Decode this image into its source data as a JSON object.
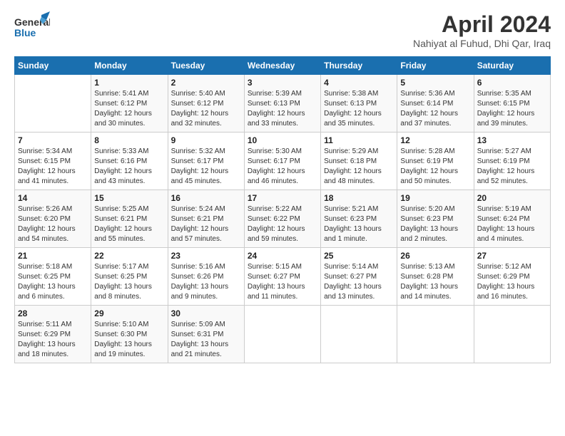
{
  "logo": {
    "line1": "General",
    "line2": "Blue"
  },
  "title": "April 2024",
  "subtitle": "Nahiyat al Fuhud, Dhi Qar, Iraq",
  "days_header": [
    "Sunday",
    "Monday",
    "Tuesday",
    "Wednesday",
    "Thursday",
    "Friday",
    "Saturday"
  ],
  "weeks": [
    [
      {
        "day": "",
        "sunrise": "",
        "sunset": "",
        "daylight": ""
      },
      {
        "day": "1",
        "sunrise": "Sunrise: 5:41 AM",
        "sunset": "Sunset: 6:12 PM",
        "daylight": "Daylight: 12 hours and 30 minutes."
      },
      {
        "day": "2",
        "sunrise": "Sunrise: 5:40 AM",
        "sunset": "Sunset: 6:12 PM",
        "daylight": "Daylight: 12 hours and 32 minutes."
      },
      {
        "day": "3",
        "sunrise": "Sunrise: 5:39 AM",
        "sunset": "Sunset: 6:13 PM",
        "daylight": "Daylight: 12 hours and 33 minutes."
      },
      {
        "day": "4",
        "sunrise": "Sunrise: 5:38 AM",
        "sunset": "Sunset: 6:13 PM",
        "daylight": "Daylight: 12 hours and 35 minutes."
      },
      {
        "day": "5",
        "sunrise": "Sunrise: 5:36 AM",
        "sunset": "Sunset: 6:14 PM",
        "daylight": "Daylight: 12 hours and 37 minutes."
      },
      {
        "day": "6",
        "sunrise": "Sunrise: 5:35 AM",
        "sunset": "Sunset: 6:15 PM",
        "daylight": "Daylight: 12 hours and 39 minutes."
      }
    ],
    [
      {
        "day": "7",
        "sunrise": "Sunrise: 5:34 AM",
        "sunset": "Sunset: 6:15 PM",
        "daylight": "Daylight: 12 hours and 41 minutes."
      },
      {
        "day": "8",
        "sunrise": "Sunrise: 5:33 AM",
        "sunset": "Sunset: 6:16 PM",
        "daylight": "Daylight: 12 hours and 43 minutes."
      },
      {
        "day": "9",
        "sunrise": "Sunrise: 5:32 AM",
        "sunset": "Sunset: 6:17 PM",
        "daylight": "Daylight: 12 hours and 45 minutes."
      },
      {
        "day": "10",
        "sunrise": "Sunrise: 5:30 AM",
        "sunset": "Sunset: 6:17 PM",
        "daylight": "Daylight: 12 hours and 46 minutes."
      },
      {
        "day": "11",
        "sunrise": "Sunrise: 5:29 AM",
        "sunset": "Sunset: 6:18 PM",
        "daylight": "Daylight: 12 hours and 48 minutes."
      },
      {
        "day": "12",
        "sunrise": "Sunrise: 5:28 AM",
        "sunset": "Sunset: 6:19 PM",
        "daylight": "Daylight: 12 hours and 50 minutes."
      },
      {
        "day": "13",
        "sunrise": "Sunrise: 5:27 AM",
        "sunset": "Sunset: 6:19 PM",
        "daylight": "Daylight: 12 hours and 52 minutes."
      }
    ],
    [
      {
        "day": "14",
        "sunrise": "Sunrise: 5:26 AM",
        "sunset": "Sunset: 6:20 PM",
        "daylight": "Daylight: 12 hours and 54 minutes."
      },
      {
        "day": "15",
        "sunrise": "Sunrise: 5:25 AM",
        "sunset": "Sunset: 6:21 PM",
        "daylight": "Daylight: 12 hours and 55 minutes."
      },
      {
        "day": "16",
        "sunrise": "Sunrise: 5:24 AM",
        "sunset": "Sunset: 6:21 PM",
        "daylight": "Daylight: 12 hours and 57 minutes."
      },
      {
        "day": "17",
        "sunrise": "Sunrise: 5:22 AM",
        "sunset": "Sunset: 6:22 PM",
        "daylight": "Daylight: 12 hours and 59 minutes."
      },
      {
        "day": "18",
        "sunrise": "Sunrise: 5:21 AM",
        "sunset": "Sunset: 6:23 PM",
        "daylight": "Daylight: 13 hours and 1 minute."
      },
      {
        "day": "19",
        "sunrise": "Sunrise: 5:20 AM",
        "sunset": "Sunset: 6:23 PM",
        "daylight": "Daylight: 13 hours and 2 minutes."
      },
      {
        "day": "20",
        "sunrise": "Sunrise: 5:19 AM",
        "sunset": "Sunset: 6:24 PM",
        "daylight": "Daylight: 13 hours and 4 minutes."
      }
    ],
    [
      {
        "day": "21",
        "sunrise": "Sunrise: 5:18 AM",
        "sunset": "Sunset: 6:25 PM",
        "daylight": "Daylight: 13 hours and 6 minutes."
      },
      {
        "day": "22",
        "sunrise": "Sunrise: 5:17 AM",
        "sunset": "Sunset: 6:25 PM",
        "daylight": "Daylight: 13 hours and 8 minutes."
      },
      {
        "day": "23",
        "sunrise": "Sunrise: 5:16 AM",
        "sunset": "Sunset: 6:26 PM",
        "daylight": "Daylight: 13 hours and 9 minutes."
      },
      {
        "day": "24",
        "sunrise": "Sunrise: 5:15 AM",
        "sunset": "Sunset: 6:27 PM",
        "daylight": "Daylight: 13 hours and 11 minutes."
      },
      {
        "day": "25",
        "sunrise": "Sunrise: 5:14 AM",
        "sunset": "Sunset: 6:27 PM",
        "daylight": "Daylight: 13 hours and 13 minutes."
      },
      {
        "day": "26",
        "sunrise": "Sunrise: 5:13 AM",
        "sunset": "Sunset: 6:28 PM",
        "daylight": "Daylight: 13 hours and 14 minutes."
      },
      {
        "day": "27",
        "sunrise": "Sunrise: 5:12 AM",
        "sunset": "Sunset: 6:29 PM",
        "daylight": "Daylight: 13 hours and 16 minutes."
      }
    ],
    [
      {
        "day": "28",
        "sunrise": "Sunrise: 5:11 AM",
        "sunset": "Sunset: 6:29 PM",
        "daylight": "Daylight: 13 hours and 18 minutes."
      },
      {
        "day": "29",
        "sunrise": "Sunrise: 5:10 AM",
        "sunset": "Sunset: 6:30 PM",
        "daylight": "Daylight: 13 hours and 19 minutes."
      },
      {
        "day": "30",
        "sunrise": "Sunrise: 5:09 AM",
        "sunset": "Sunset: 6:31 PM",
        "daylight": "Daylight: 13 hours and 21 minutes."
      },
      {
        "day": "",
        "sunrise": "",
        "sunset": "",
        "daylight": ""
      },
      {
        "day": "",
        "sunrise": "",
        "sunset": "",
        "daylight": ""
      },
      {
        "day": "",
        "sunrise": "",
        "sunset": "",
        "daylight": ""
      },
      {
        "day": "",
        "sunrise": "",
        "sunset": "",
        "daylight": ""
      }
    ]
  ]
}
